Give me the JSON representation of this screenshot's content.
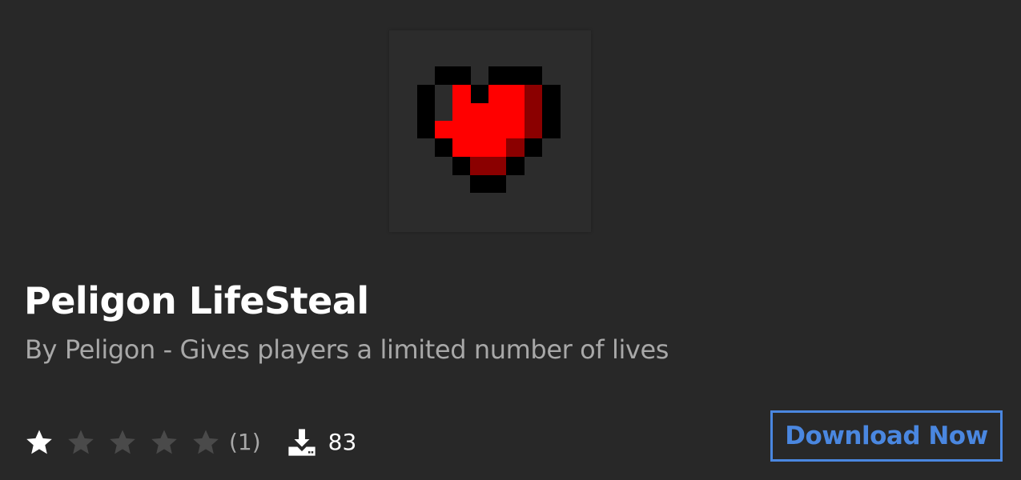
{
  "plugin": {
    "title": "Peligon LifeSteal",
    "subtitle": "By Peligon - Gives players a limited number of lives",
    "thumbnail_icon": "pixel-heart-icon"
  },
  "stats": {
    "rating_value": 1,
    "rating_max": 5,
    "rating_count_label": "(1)",
    "downloads_label": "83"
  },
  "actions": {
    "download_label": "Download Now"
  },
  "colors": {
    "background": "#282828",
    "thumbnail_bg": "#2d2d2d",
    "accent": "#4a87e0",
    "star_filled": "#ffffff",
    "star_empty": "#4a4a4a",
    "heart_red": "#ff0000",
    "heart_dark_red": "#8b0000"
  }
}
